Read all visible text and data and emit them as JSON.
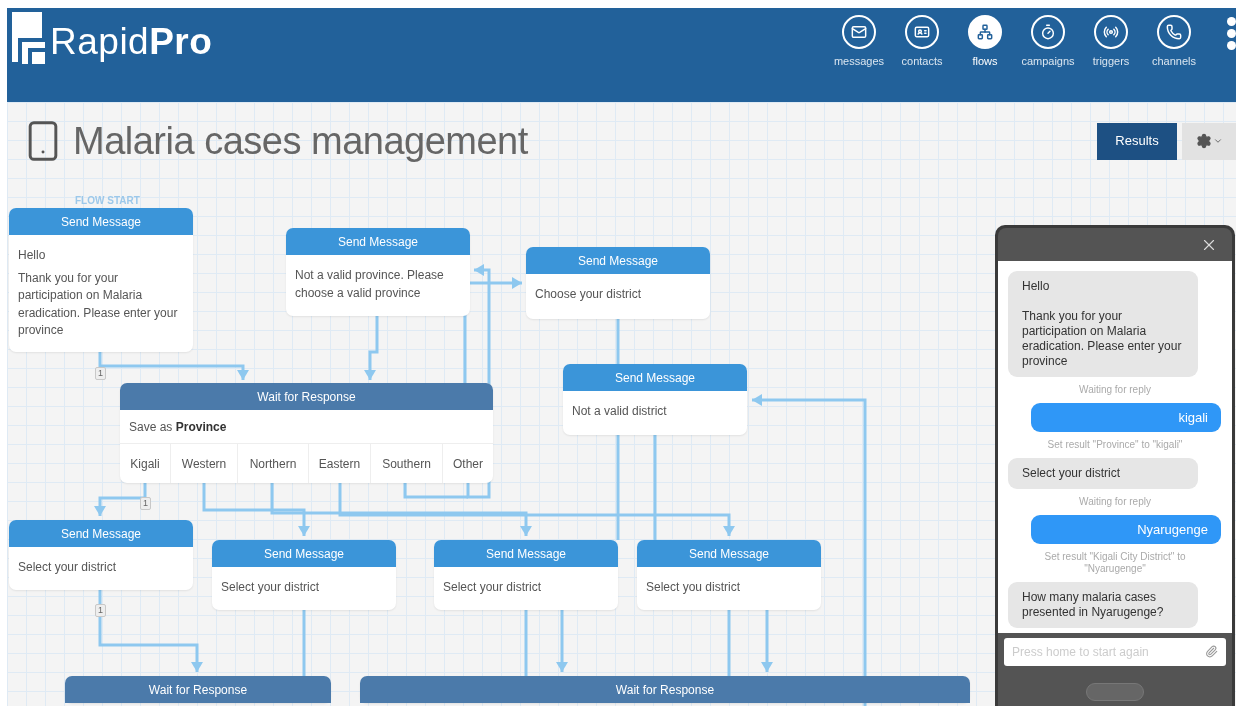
{
  "header": {
    "logo": "Rapid**Pro**",
    "nav": [
      {
        "kind": "messages",
        "label": "messages",
        "selected": false
      },
      {
        "kind": "contacts",
        "label": "contacts",
        "selected": false
      },
      {
        "kind": "flows",
        "label": "flows",
        "selected": true
      },
      {
        "kind": "campaigns",
        "label": "campaigns",
        "selected": false
      },
      {
        "kind": "triggers",
        "label": "triggers",
        "selected": false
      },
      {
        "kind": "channels",
        "label": "channels",
        "selected": false
      }
    ]
  },
  "flow": {
    "title": "Malaria cases management",
    "results_button": "Results",
    "flow_start_label": "FLOW START",
    "nodes": [
      {
        "kind": "send",
        "title": "Send Message",
        "text": [
          "Hello",
          "Thank you for your participation on Malaria eradication. Please enter your province"
        ],
        "exit_count": "1"
      },
      {
        "kind": "send",
        "title": "Send Message",
        "text": [
          "Not a valid province. Please choose a valid province"
        ]
      },
      {
        "kind": "send",
        "title": "Send Message",
        "text": [
          "Choose your district"
        ]
      },
      {
        "kind": "wait",
        "title": "Wait for Response",
        "save_as": "Save as **Province**",
        "categories": [
          {
            "label": "Kigali",
            "exit_count": "1"
          },
          {
            "label": "Western"
          },
          {
            "label": "Northern"
          },
          {
            "label": "Eastern"
          },
          {
            "label": "Southern"
          },
          {
            "label": "Other"
          }
        ]
      },
      {
        "kind": "send",
        "title": "Send Message",
        "text": [
          "Not a valid district"
        ]
      },
      {
        "kind": "send",
        "title": "Send Message",
        "text": [
          "Select your district"
        ],
        "exit_count": "1"
      },
      {
        "kind": "send",
        "title": "Send Message",
        "text": [
          "Select your district"
        ]
      },
      {
        "kind": "send",
        "title": "Send Message",
        "text": [
          "Select your district"
        ]
      },
      {
        "kind": "send",
        "title": "Send Message",
        "text": [
          "Select you district"
        ]
      },
      {
        "kind": "wait",
        "title": "Wait for Response"
      },
      {
        "kind": "wait",
        "title": "Wait for Response"
      }
    ]
  },
  "simulator": {
    "messages": [
      {
        "kind": "incoming",
        "text": [
          "Hello",
          "Thank you for your participation on Malaria eradication. Please enter your province"
        ]
      },
      {
        "kind": "status",
        "text": [
          "Waiting for reply"
        ]
      },
      {
        "kind": "outgoing",
        "text": [
          "kigali"
        ]
      },
      {
        "kind": "status",
        "text": [
          "Set result \"Province\" to \"kigali\""
        ]
      },
      {
        "kind": "incoming",
        "text": [
          "Select your district"
        ]
      },
      {
        "kind": "status",
        "text": [
          "Waiting for reply"
        ]
      },
      {
        "kind": "outgoing",
        "text": [
          "Nyarugenge"
        ]
      },
      {
        "kind": "status",
        "text": [
          "Set result \"Kigali City District\" to \"Nyarugenge\""
        ]
      },
      {
        "kind": "incoming",
        "text": [
          "How many malaria cases presented in Nyarugenge?"
        ]
      }
    ],
    "input": {
      "placeholder": "Press home to start again"
    }
  }
}
